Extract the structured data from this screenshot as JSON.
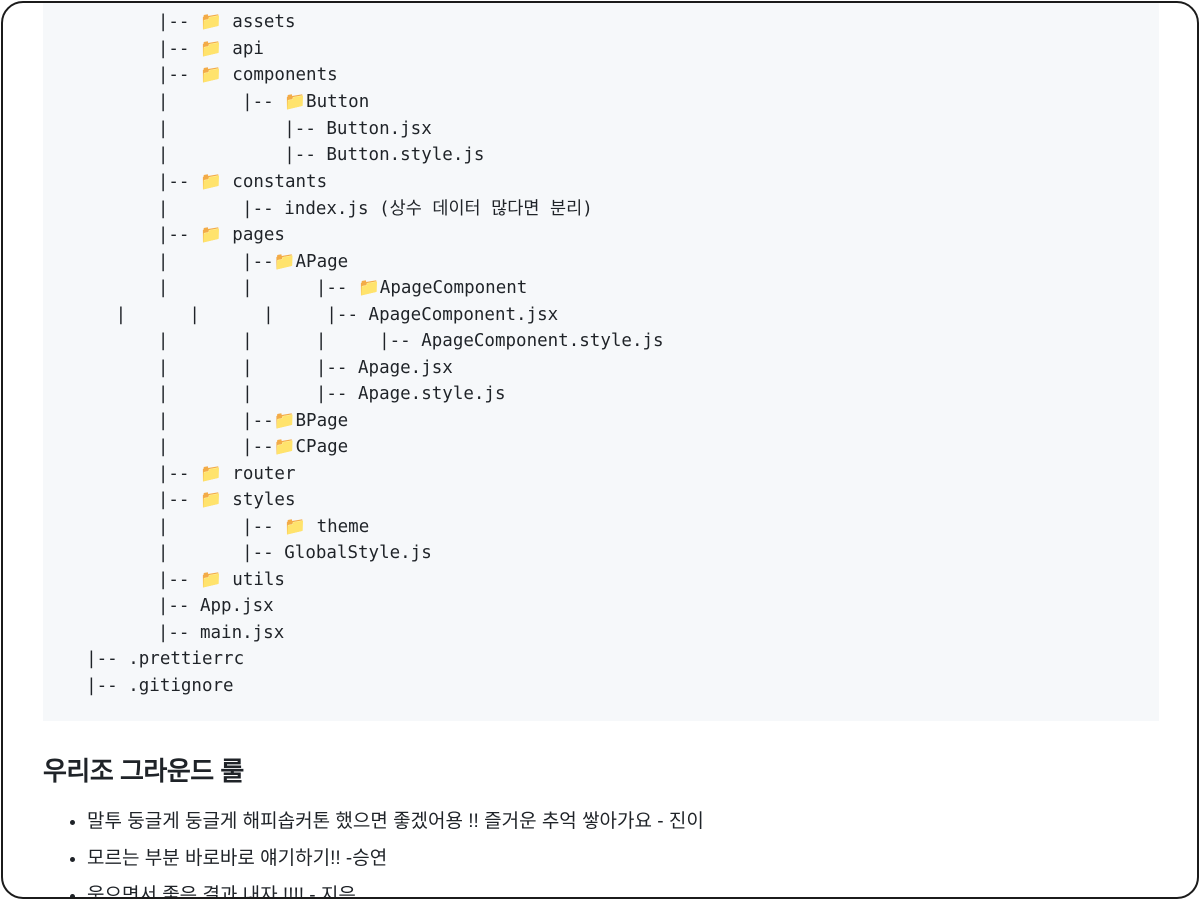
{
  "tree": {
    "lines": [
      "         |-- 📁 assets",
      "         |-- 📁 api",
      "         |-- 📁 components",
      "         |       |-- 📁Button",
      "         |           |-- Button.jsx",
      "         |           |-- Button.style.js",
      "         |-- 📁 constants",
      "         |       |-- index.js (상수 데이터 많다면 분리)",
      "         |-- 📁 pages",
      "         |       |--📁APage",
      "         |       |      |-- 📁ApageComponent",
      "     |      |      |     |-- ApageComponent.jsx",
      "         |       |      |     |-- ApageComponent.style.js",
      "         |       |      |-- Apage.jsx",
      "         |       |      |-- Apage.style.js",
      "         |       |--📁BPage",
      "         |       |--📁CPage",
      "         |-- 📁 router",
      "         |-- 📁 styles",
      "         |       |-- 📁 theme",
      "         |       |-- GlobalStyle.js",
      "         |-- 📁 utils",
      "         |-- App.jsx",
      "         |-- main.jsx",
      "  |-- .prettierrc",
      "  |-- .gitignore"
    ]
  },
  "ground_rules": {
    "heading": "우리조 그라운드 룰",
    "items": [
      "말투 둥글게 둥글게 해피솝커톤 했으면 좋겠어용 !! 즐거운 추억 쌓아가요 - 진이",
      "모르는 부분 바로바로 얘기하기!! -승연",
      "웃으면서 좋은 결과 내자 !!!! - 지은"
    ]
  }
}
